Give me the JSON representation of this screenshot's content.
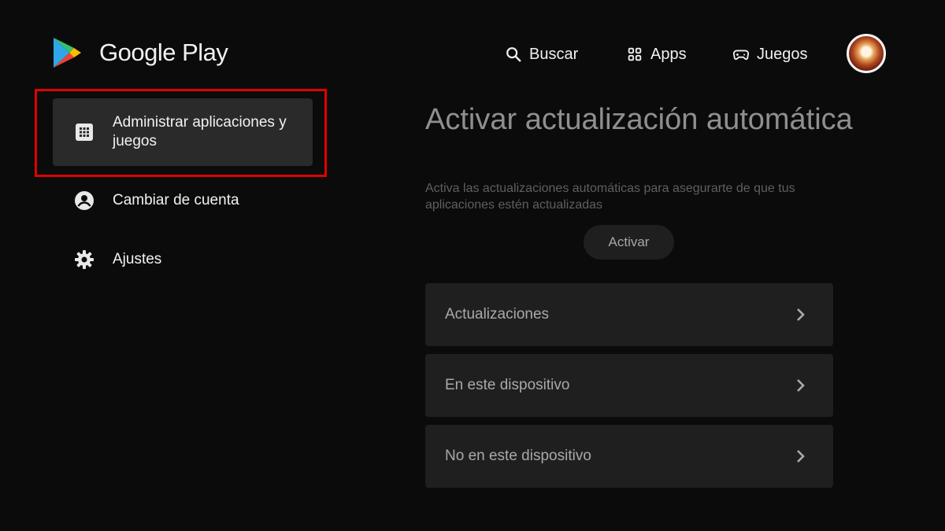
{
  "app": {
    "name": "Google Play"
  },
  "topnav": {
    "search_label": "Buscar",
    "apps_label": "Apps",
    "games_label": "Juegos"
  },
  "sidebar": {
    "items": [
      {
        "label": "Administrar aplicaciones y juegos",
        "icon": "apps-grid-icon",
        "selected": true
      },
      {
        "label": "Cambiar de cuenta",
        "icon": "account-circle-icon",
        "selected": false
      },
      {
        "label": "Ajustes",
        "icon": "gear-icon",
        "selected": false
      }
    ]
  },
  "main": {
    "title": "Activar actualización automática",
    "subtitle": "Activa las actualizaciones automáticas para asegurarte de que tus aplicaciones estén actualizadas",
    "activate_label": "Activar",
    "rows": [
      {
        "label": "Actualizaciones",
        "icon": "chevron-right-icon"
      },
      {
        "label": "En este dispositivo",
        "icon": "chevron-right-icon"
      },
      {
        "label": "No en este dispositivo",
        "icon": "chevron-right-icon"
      }
    ]
  },
  "colors": {
    "background": "#0b0b0b",
    "selected_item": "#2a2a2a",
    "highlight_border": "#e00000",
    "row_background": "#1f1f1f"
  }
}
